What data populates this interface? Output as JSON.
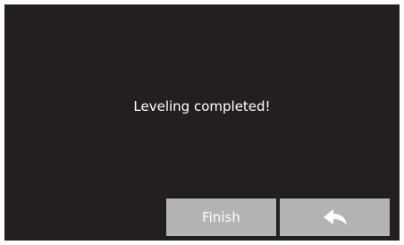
{
  "dialog": {
    "message": "Leveling completed!"
  },
  "buttons": {
    "finish_label": "Finish",
    "back_icon": "back-arrow-icon"
  },
  "colors": {
    "background": "#231f20",
    "button": "#b3b3b3",
    "text": "#ffffff"
  }
}
